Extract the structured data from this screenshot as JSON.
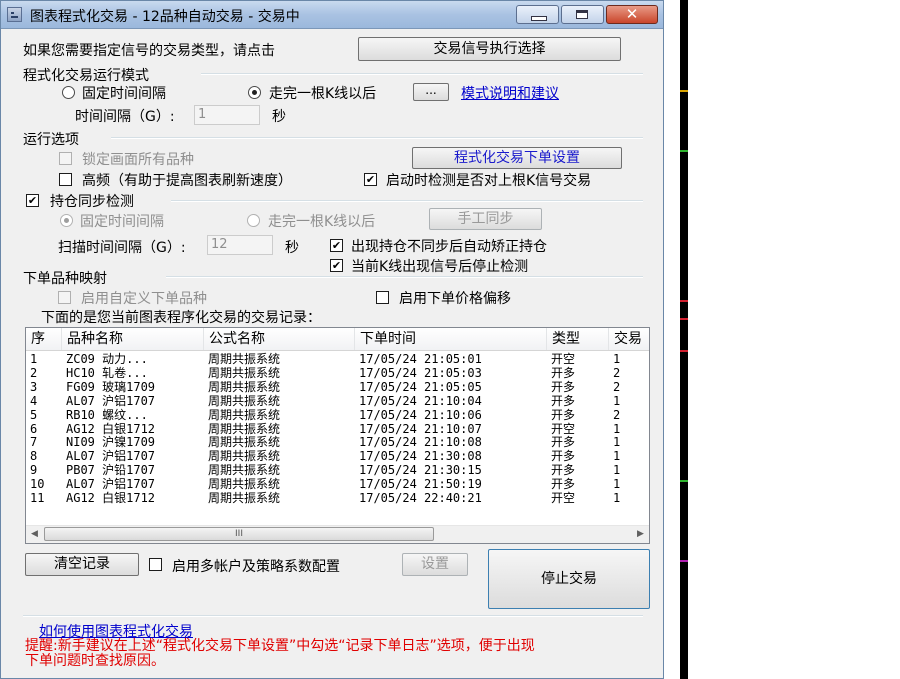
{
  "window": {
    "title": "图表程式化交易 - 12品种自动交易 - 交易中",
    "close_symbol": "✕"
  },
  "signal": {
    "prompt": "如果您需要指定信号的交易类型，请点击",
    "button": "交易信号执行选择"
  },
  "run_mode": {
    "group_label": "程式化交易运行模式",
    "option_fixed": "固定时间间隔",
    "option_bar": "走完一根K线以后",
    "ellipsis_button": "...",
    "help_link": "模式说明和建议",
    "interval_label": "时间间隔（G）:",
    "interval_value": "1",
    "unit": "秒"
  },
  "options": {
    "group_label": "运行选项",
    "lock_all": "锁定画面所有品种",
    "order_settings_button": "程式化交易下单设置",
    "high_freq": "高频（有助于提高图表刷新速度）",
    "check_last_bar": "启动时检测是否对上根K信号交易"
  },
  "position_sync": {
    "group_label": "持仓同步检测",
    "option_fixed": "固定时间间隔",
    "option_bar": "走完一根K线以后",
    "manual_button": "手工同步",
    "scan_label": "扫描时间间隔（G）:",
    "scan_value": "12",
    "unit": "秒",
    "auto_fix": "出现持仓不同步后自动矫正持仓",
    "stop_on_signal": "当前K线出现信号后停止检测"
  },
  "mapping": {
    "group_label": "下单品种映射",
    "custom_symbol": "启用自定义下单品种",
    "price_offset": "启用下单价格偏移"
  },
  "records": {
    "caption": "下面的是您当前图表程序化交易的交易记录：",
    "columns": [
      "序",
      "品种名称",
      "公式名称",
      "下单时间",
      "类型",
      "交易"
    ],
    "rows": [
      [
        "1",
        "ZC09 动力...",
        "周期共振系统",
        "17/05/24 21:05:01",
        "开空",
        "1"
      ],
      [
        "2",
        "HC10 轧卷...",
        "周期共振系统",
        "17/05/24 21:05:03",
        "开多",
        "2"
      ],
      [
        "3",
        "FG09 玻璃1709",
        "周期共振系统",
        "17/05/24 21:05:05",
        "开多",
        "2"
      ],
      [
        "4",
        "AL07 沪铝1707",
        "周期共振系统",
        "17/05/24 21:10:04",
        "开多",
        "1"
      ],
      [
        "5",
        "RB10 螺纹...",
        "周期共振系统",
        "17/05/24 21:10:06",
        "开多",
        "2"
      ],
      [
        "6",
        "AG12 白银1712",
        "周期共振系统",
        "17/05/24 21:10:07",
        "开空",
        "1"
      ],
      [
        "7",
        "NI09 沪镍1709",
        "周期共振系统",
        "17/05/24 21:10:08",
        "开多",
        "1"
      ],
      [
        "8",
        "AL07 沪铝1707",
        "周期共振系统",
        "17/05/24 21:30:08",
        "开多",
        "1"
      ],
      [
        "9",
        "PB07 沪铅1707",
        "周期共振系统",
        "17/05/24 21:30:15",
        "开多",
        "1"
      ],
      [
        "10",
        "AL07 沪铝1707",
        "周期共振系统",
        "17/05/24 21:50:19",
        "开多",
        "1"
      ],
      [
        "11",
        "AG12 白银1712",
        "周期共振系统",
        "17/05/24 22:40:21",
        "开空",
        "1"
      ]
    ],
    "scroll_left": "◀",
    "scroll_right": "▶",
    "scroll_grip": "III"
  },
  "bottom": {
    "clear_button": "清空记录",
    "multi_account": "启用多帐户及策略系数配置",
    "settings_button": "设置",
    "stop_button": "停止交易",
    "howto_link": "如何使用图表程式化交易",
    "hint": "提醒:新手建议在上述“程式化交易下单设置”中勾选“记录下单日志”选项，便于出现下单问题时查找原因。"
  },
  "checkmark": "✔",
  "colors": {
    "hint": "#e00000",
    "link": "#0000cc",
    "titlebar": "#a9c2e2",
    "close": "#c9452b"
  }
}
